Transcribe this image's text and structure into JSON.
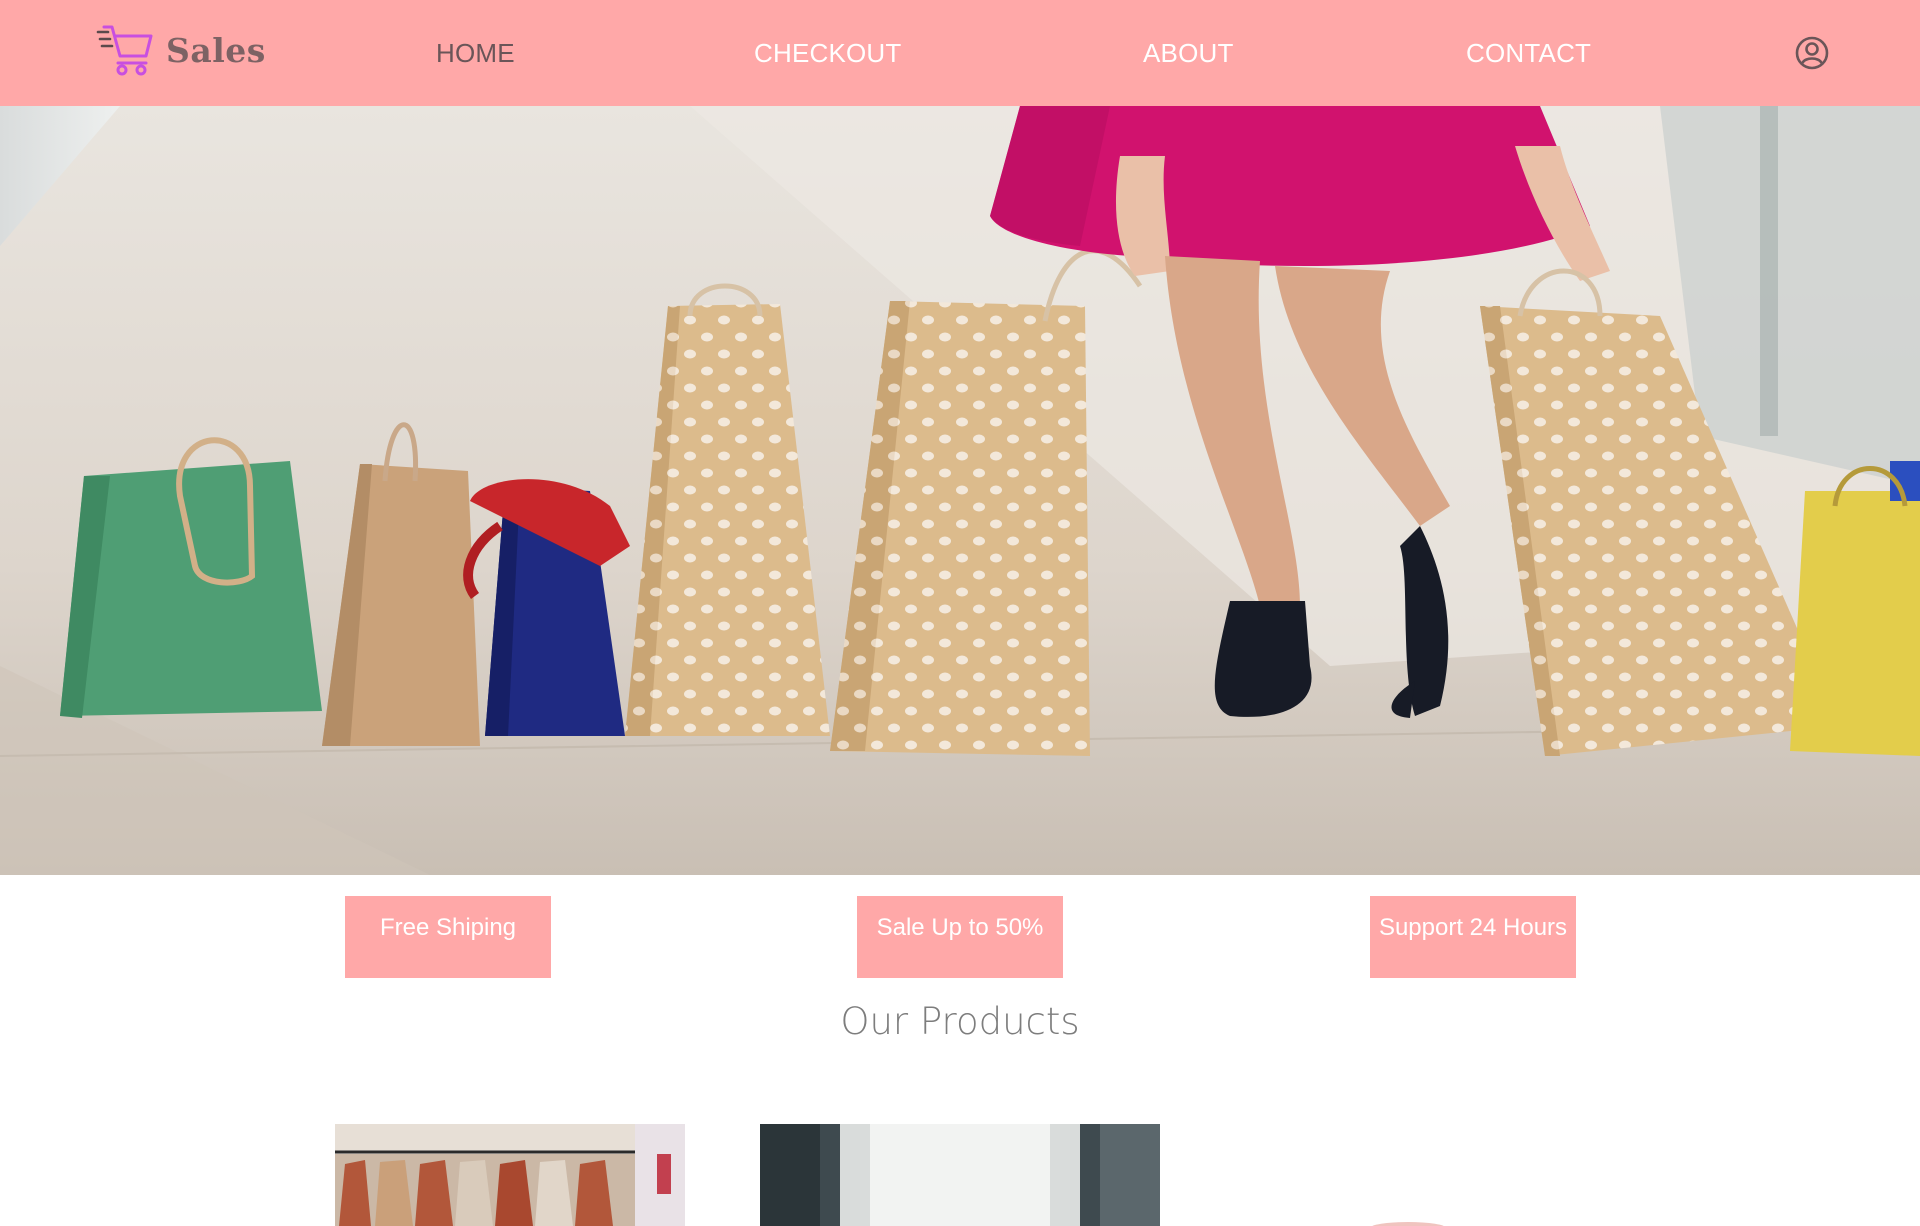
{
  "brand": {
    "name": "Sales",
    "icon": "shopping-cart-icon"
  },
  "nav": {
    "items": [
      {
        "label": "HOME",
        "active": true
      },
      {
        "label": "CHECKOUT",
        "active": false
      },
      {
        "label": "ABOUT",
        "active": false
      },
      {
        "label": "CONTACT",
        "active": false
      }
    ],
    "account_icon": "user-circle-icon"
  },
  "hero": {
    "image": "woman-with-shopping-bags-in-mall"
  },
  "features": [
    "Free Shiping",
    "Sale Up to 50%",
    "Support 24 Hours"
  ],
  "products": {
    "title": "Our Products",
    "items": [
      {
        "image": "clothes-on-hangers"
      },
      {
        "image": "grey-textured-backdrop"
      },
      {
        "image": "round-product"
      }
    ]
  },
  "colors": {
    "accent": "#ffa8a8",
    "brand_text": "#7d6264",
    "active_nav": "#6a5558",
    "cart_icon": "#c84fe0"
  }
}
